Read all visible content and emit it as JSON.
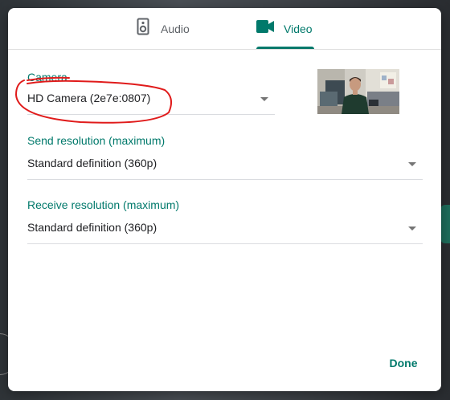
{
  "tabs": [
    {
      "label": "Audio",
      "icon": "speaker-icon"
    },
    {
      "label": "Video",
      "icon": "video-camera-icon",
      "active": true
    }
  ],
  "camera": {
    "label": "Camera",
    "value": "HD Camera (2e7e:0807)"
  },
  "send_resolution": {
    "label": "Send resolution (maximum)",
    "value": "Standard definition (360p)"
  },
  "receive_resolution": {
    "label": "Receive resolution (maximum)",
    "value": "Standard definition (360p)"
  },
  "done_label": "Done",
  "colors": {
    "accent": "#00796b",
    "annotation": "#e01b1b"
  }
}
